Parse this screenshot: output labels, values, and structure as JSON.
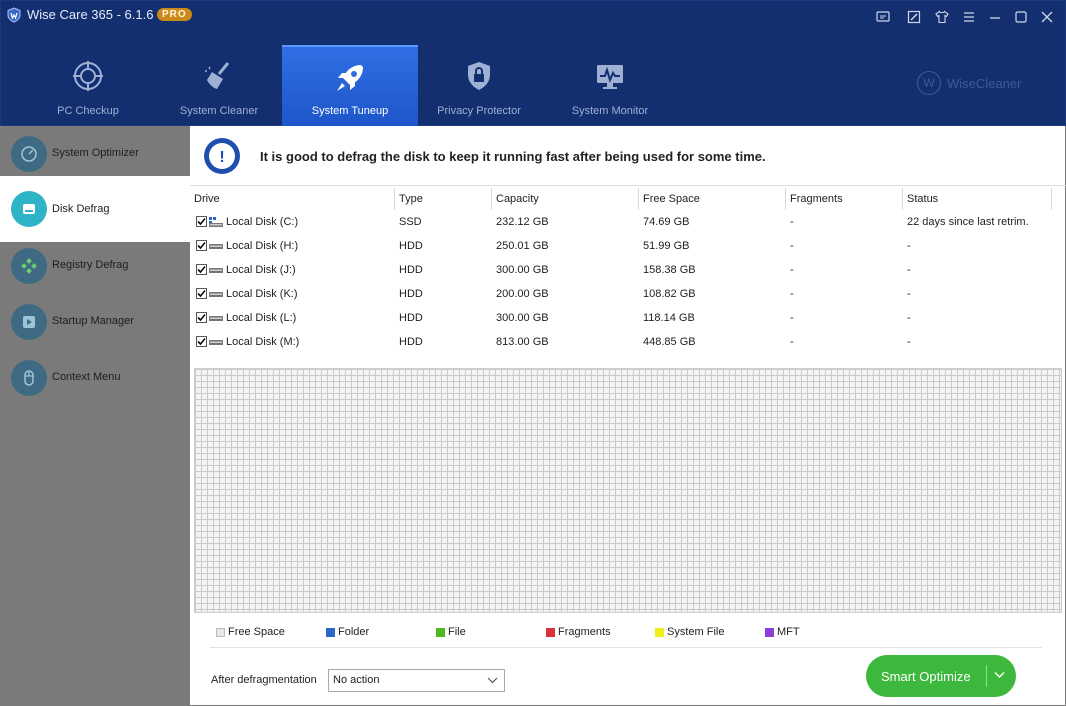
{
  "window": {
    "title": "Wise Care 365 - 6.1.6",
    "badge": "PRO",
    "controls": [
      "feedback-icon",
      "skin-icon",
      "shirt-icon",
      "menu-icon",
      "minimize-icon",
      "maximize-icon",
      "close-icon"
    ]
  },
  "nav": {
    "tabs": [
      {
        "label": "PC Checkup",
        "icon": "target-icon"
      },
      {
        "label": "System Cleaner",
        "icon": "broom-icon"
      },
      {
        "label": "System Tuneup",
        "icon": "rocket-icon",
        "active": true
      },
      {
        "label": "Privacy Protector",
        "icon": "lock-shield-icon"
      },
      {
        "label": "System Monitor",
        "icon": "monitor-icon"
      }
    ],
    "brand": "WiseCleaner",
    "brand_mark": "W"
  },
  "sidebar": {
    "items": [
      {
        "label": "System Optimizer",
        "icon": "speedometer-icon"
      },
      {
        "label": "Disk Defrag",
        "icon": "disk-icon",
        "active": true
      },
      {
        "label": "Registry Defrag",
        "icon": "registry-icon"
      },
      {
        "label": "Startup Manager",
        "icon": "play-icon"
      },
      {
        "label": "Context Menu",
        "icon": "mouse-icon"
      }
    ]
  },
  "info": {
    "icon_text": "!",
    "message": "It is good to defrag the disk to keep it running fast after being used for some time."
  },
  "table": {
    "headers": {
      "drive": "Drive",
      "type": "Type",
      "capacity": "Capacity",
      "free": "Free Space",
      "fragments": "Fragments",
      "status": "Status"
    },
    "rows": [
      {
        "checked": true,
        "drive": "Local Disk (C:)",
        "type": "SSD",
        "capacity": "232.12 GB",
        "free": "74.69 GB",
        "fragments": "-",
        "status": "22 days since last retrim.",
        "icon": "windows-disk-icon"
      },
      {
        "checked": true,
        "drive": "Local Disk (H:)",
        "type": "HDD",
        "capacity": "250.01 GB",
        "free": "51.99 GB",
        "fragments": "-",
        "status": "-",
        "icon": "disk-icon"
      },
      {
        "checked": true,
        "drive": "Local Disk (J:)",
        "type": "HDD",
        "capacity": "300.00 GB",
        "free": "158.38 GB",
        "fragments": "-",
        "status": "-",
        "icon": "disk-icon"
      },
      {
        "checked": true,
        "drive": "Local Disk (K:)",
        "type": "HDD",
        "capacity": "200.00 GB",
        "free": "108.82 GB",
        "fragments": "-",
        "status": "-",
        "icon": "disk-icon"
      },
      {
        "checked": true,
        "drive": "Local Disk (L:)",
        "type": "HDD",
        "capacity": "300.00 GB",
        "free": "118.14 GB",
        "fragments": "-",
        "status": "-",
        "icon": "disk-icon"
      },
      {
        "checked": true,
        "drive": "Local Disk (M:)",
        "type": "HDD",
        "capacity": "813.00 GB",
        "free": "448.85 GB",
        "fragments": "-",
        "status": "-",
        "icon": "disk-icon"
      }
    ]
  },
  "legend": [
    {
      "label": "Free Space",
      "color": "#e8e8e8"
    },
    {
      "label": "Folder",
      "color": "#2b67c6"
    },
    {
      "label": "File",
      "color": "#4fb81f"
    },
    {
      "label": "Fragments",
      "color": "#d8333b"
    },
    {
      "label": "System File",
      "color": "#f0ee1a"
    },
    {
      "label": "MFT",
      "color": "#8a3fd9"
    }
  ],
  "footer": {
    "after_label": "After defragmentation",
    "after_value": "No action",
    "button_label": "Smart Optimize"
  },
  "colors": {
    "header_bg": "#132f70",
    "active_tab": "#2f6fe4",
    "sidebar_bg": "#7a7a7a",
    "accent_green": "#3cb83d"
  }
}
